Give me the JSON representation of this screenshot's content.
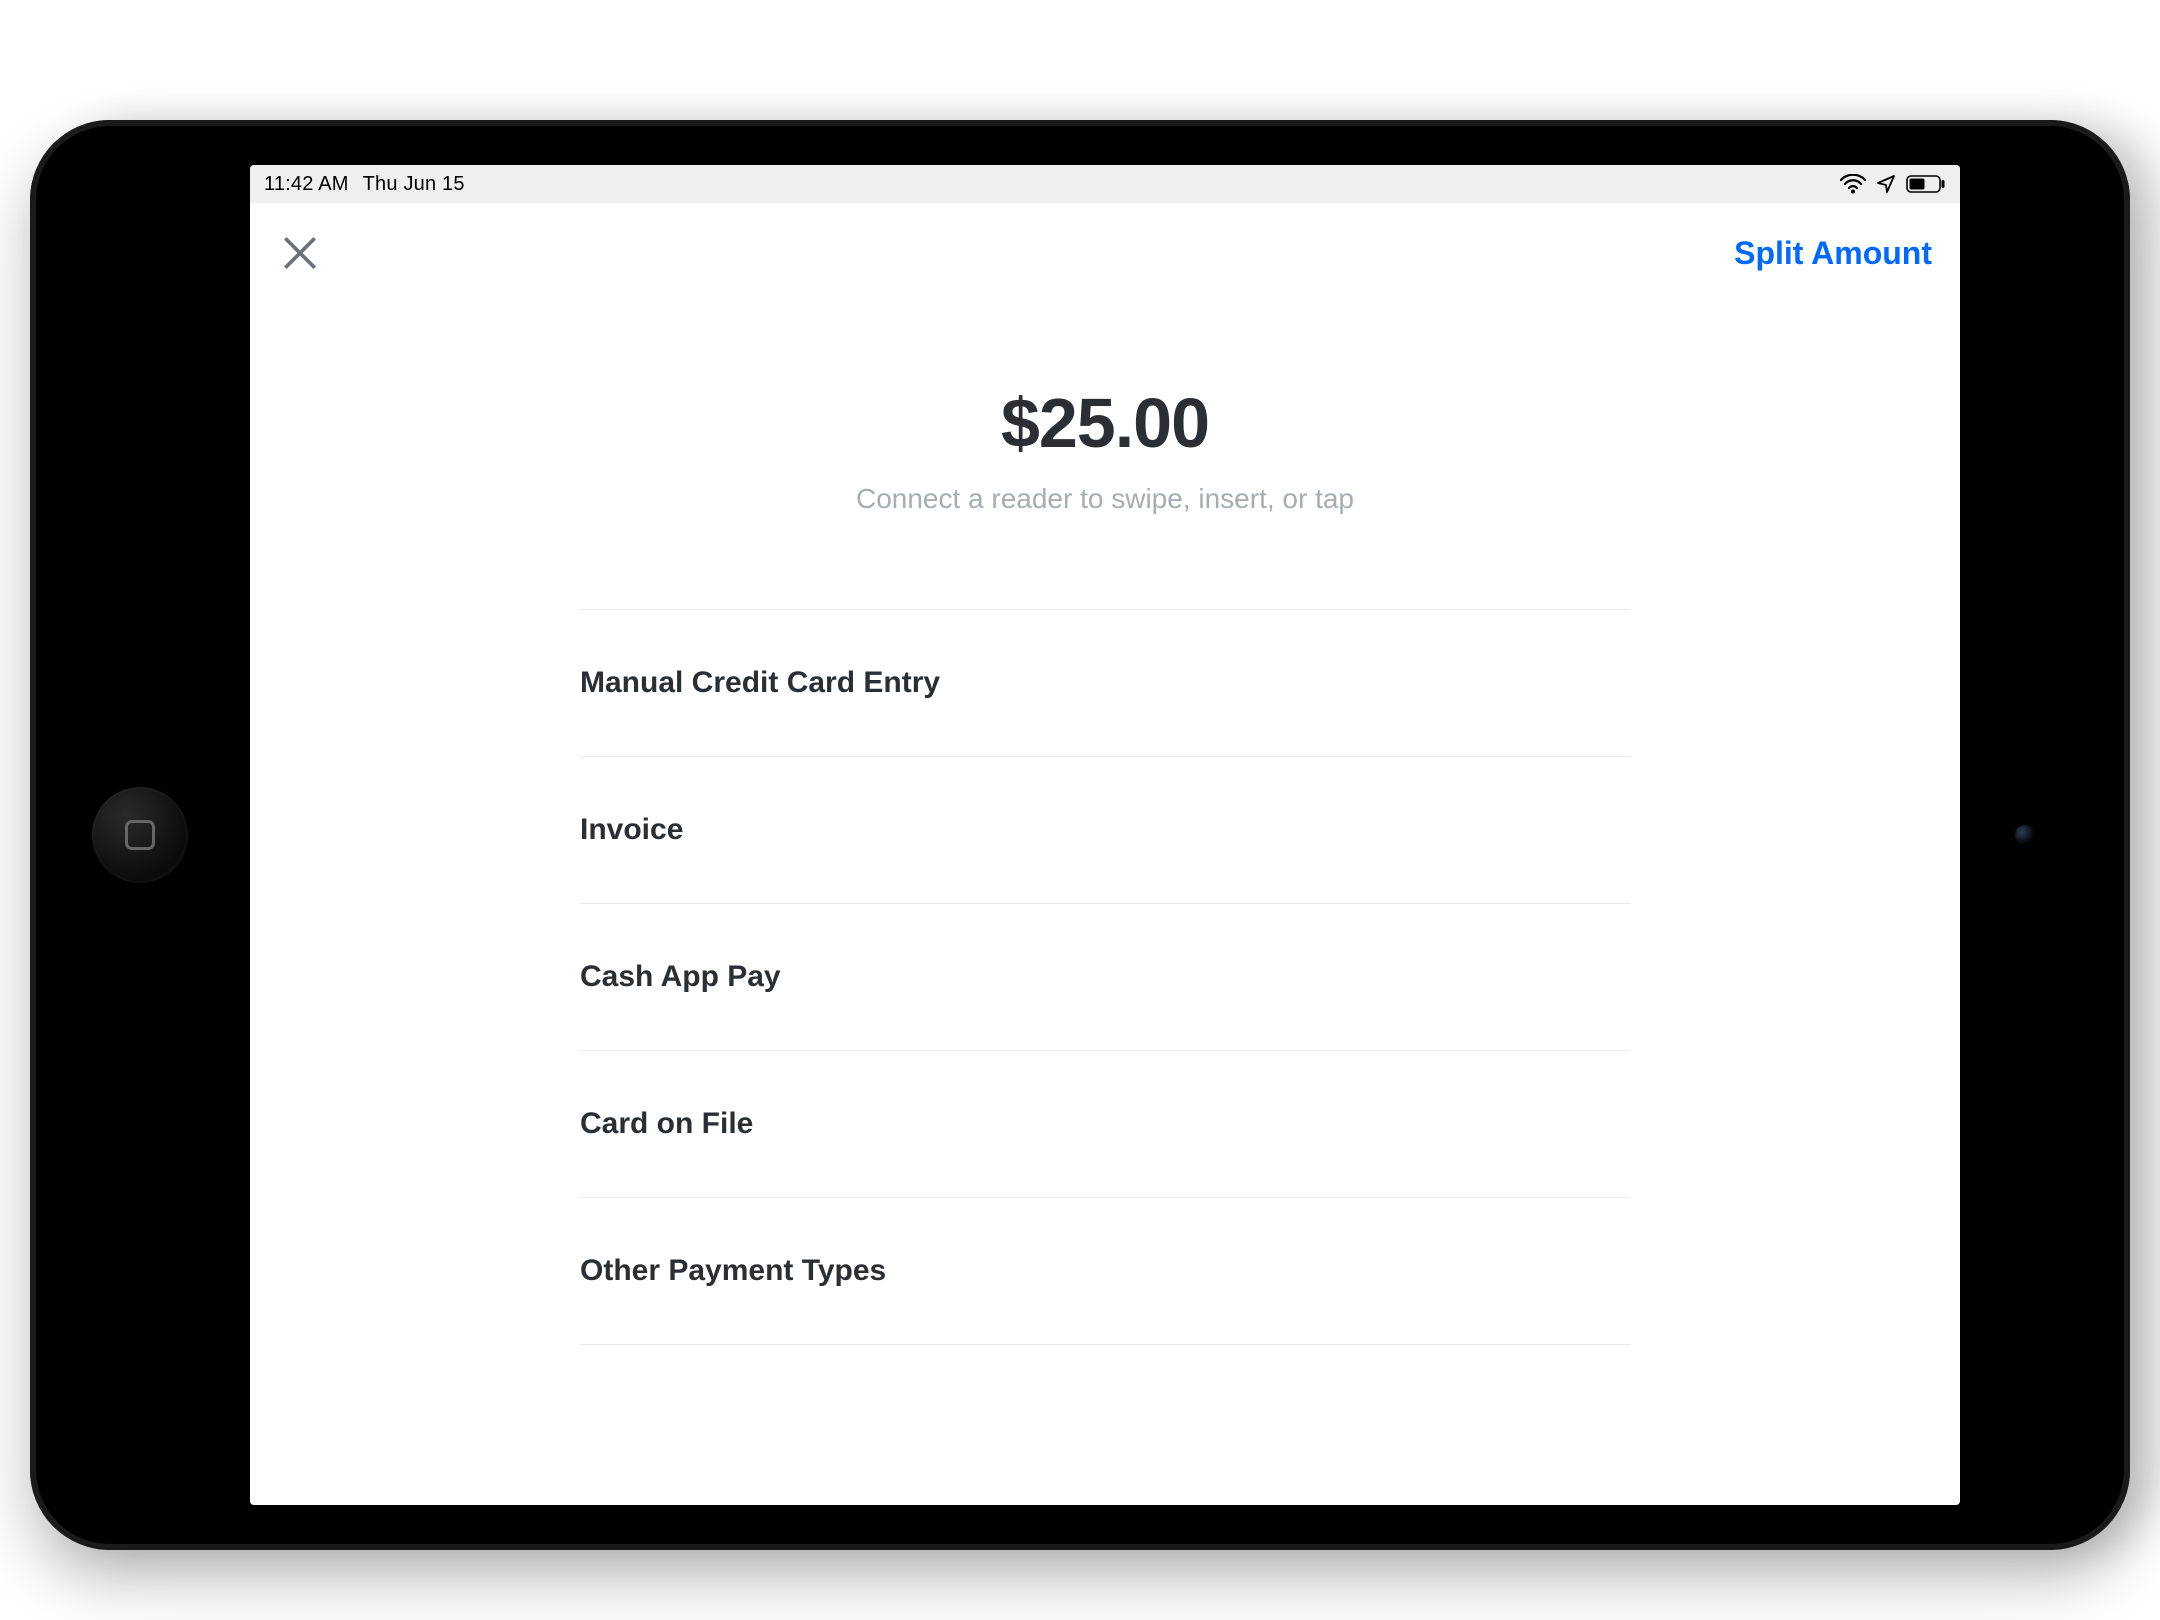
{
  "status_bar": {
    "time": "11:42 AM",
    "date": "Thu Jun 15"
  },
  "nav": {
    "split_label": "Split Amount"
  },
  "payment": {
    "amount_display": "$25.00",
    "hint": "Connect a reader to swipe, insert, or tap"
  },
  "options": [
    {
      "label": "Manual Credit Card Entry"
    },
    {
      "label": "Invoice"
    },
    {
      "label": "Cash App Pay"
    },
    {
      "label": "Card on File"
    },
    {
      "label": "Other Payment Types"
    }
  ]
}
